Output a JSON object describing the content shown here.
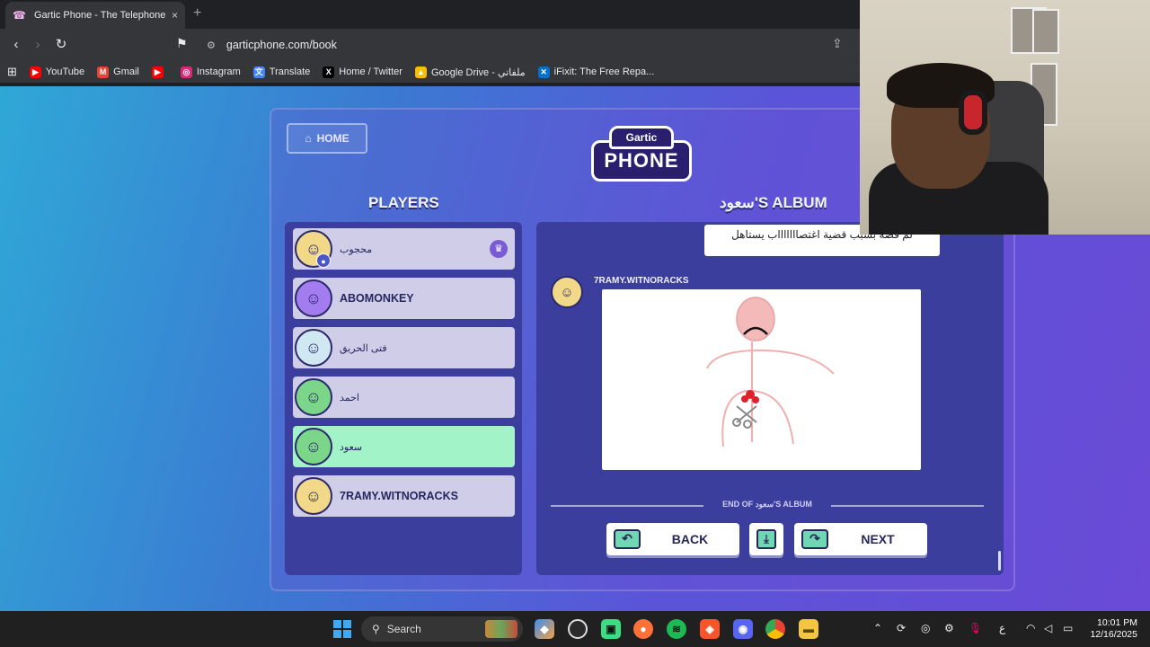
{
  "browser": {
    "tab_title": "Gartic Phone - The Telephone Game",
    "tab_close": "×",
    "new_tab": "+",
    "url": "garticphone.com/book",
    "bookmarks": [
      {
        "label": "YouTube",
        "icon": "youtube-icon",
        "color": "#ff0000",
        "glyph": "▶"
      },
      {
        "label": "Gmail",
        "icon": "gmail-icon",
        "color": "#ea4335",
        "glyph": "M"
      },
      {
        "label": "",
        "icon": "youtube-music-icon",
        "color": "#ff0000",
        "glyph": "▶"
      },
      {
        "label": "Instagram",
        "icon": "instagram-icon",
        "color": "#d62976",
        "glyph": "◎"
      },
      {
        "label": "Translate",
        "icon": "translate-icon",
        "color": "#4285f4",
        "glyph": "文"
      },
      {
        "label": "Home / Twitter",
        "icon": "x-twitter-icon",
        "color": "#000000",
        "glyph": "X"
      },
      {
        "label": "Google Drive - ملفاتي",
        "icon": "google-drive-icon",
        "color": "#fbbc04",
        "glyph": "▲"
      },
      {
        "label": "iFixit: The Free Repa...",
        "icon": "ifixit-icon",
        "color": "#0071ce",
        "glyph": "✕"
      }
    ]
  },
  "game": {
    "home_label": "HOME",
    "logo_top": "Gartic",
    "logo_word": "PHONE",
    "players_title": "PLAYERS",
    "album_title": "سعود'S ALBUM",
    "players": [
      {
        "name": "محجوب",
        "avatar": "☺",
        "color": "#f2d98a",
        "arabic": true,
        "active": false,
        "host": true
      },
      {
        "name": "ABOMONKEY",
        "avatar": "☺",
        "color": "#a37cf0",
        "arabic": false,
        "active": false,
        "host": false
      },
      {
        "name": "فتى الحريق",
        "avatar": "☺",
        "color": "#cfe8f2",
        "arabic": true,
        "active": false,
        "host": false
      },
      {
        "name": "احمد",
        "avatar": "☺",
        "color": "#7cd68a",
        "arabic": true,
        "active": false,
        "host": false
      },
      {
        "name": "سعود",
        "avatar": "☺",
        "color": "#7cd68a",
        "arabic": true,
        "active": true,
        "host": false
      },
      {
        "name": "7RAMY.WITNORACKS",
        "avatar": "☺",
        "color": "#f2d98a",
        "arabic": false,
        "active": false,
        "host": false
      }
    ],
    "phrase": "لم قصة بسبب قضية اغتصاااااااب يستاهل",
    "author_name": "7RAMY.WITNORACKS",
    "end_label": "END OF سعود'S ALBUM",
    "back_label": "BACK",
    "next_label": "NEXT"
  },
  "taskbar": {
    "search_label": "Search",
    "time": "10:01 PM",
    "date": "12/16/2025",
    "lang": "ع"
  }
}
